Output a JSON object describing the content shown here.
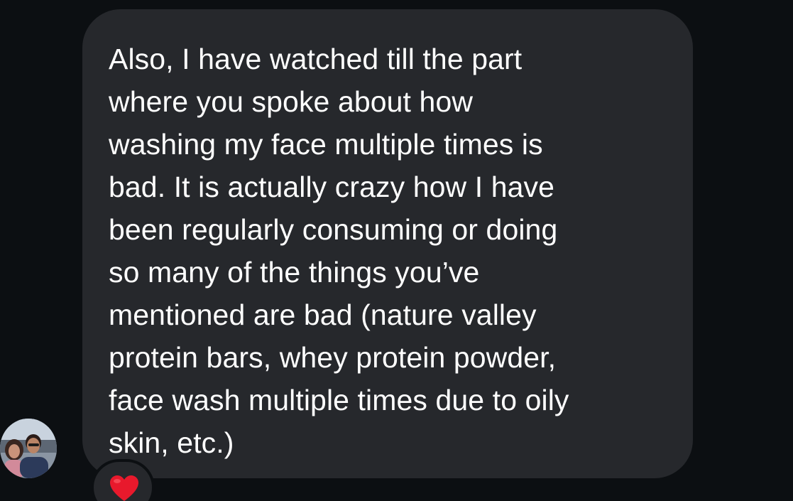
{
  "message": {
    "text": "Also, I have watched till the part\nwhere you spoke about how\nwashing my face multiple times is\nbad. It is actually crazy how I have\nbeen regularly consuming or doing\nso many of the things you’ve\nmentioned are bad (nature valley\nprotein bars, whey protein powder,\nface wash multiple times due to oily\nskin, etc.)",
    "reaction_icon": "red-heart-icon"
  },
  "sender": {
    "avatar_icon": "profile-photo"
  },
  "colors": {
    "background": "#0c0f12",
    "bubble": "#26282c",
    "text": "#ffffff",
    "heart": "#e8192c"
  }
}
